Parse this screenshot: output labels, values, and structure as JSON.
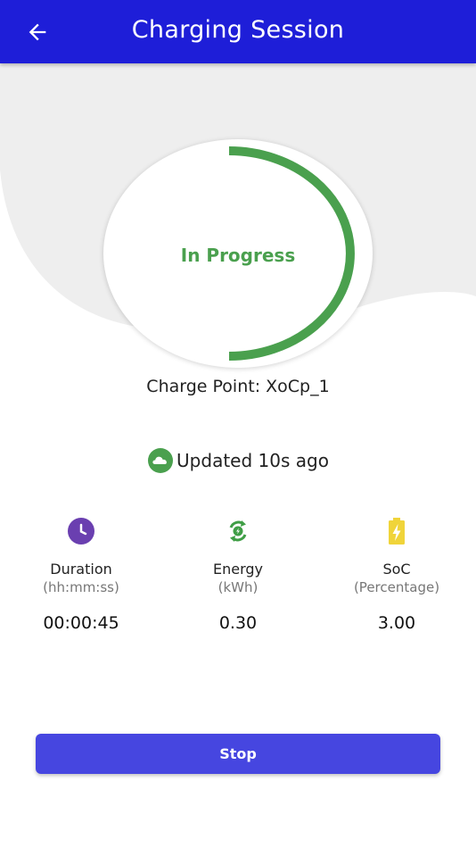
{
  "header": {
    "title": "Charging Session",
    "back_icon": "arrow-left-icon"
  },
  "status": {
    "label": "In Progress",
    "progress": 0.5,
    "color": "#4aa04e"
  },
  "charge_point": {
    "prefix": "Charge Point:",
    "id": "XoCp_1"
  },
  "updated": {
    "text": "Updated 10s ago",
    "icon": "cloud-icon"
  },
  "metrics": [
    {
      "label": "Duration",
      "unit": "(hh:mm:ss)",
      "value": "00:00:45",
      "icon": "clock-icon",
      "icon_color": "#6a3fb0"
    },
    {
      "label": "Energy",
      "unit": "(kWh)",
      "value": "0.30",
      "icon": "energy-icon",
      "icon_color": "#3f9e46"
    },
    {
      "label": "SoC",
      "unit": "(Percentage)",
      "value": "3.00",
      "icon": "battery-charging-icon",
      "icon_color": "#f0d43a"
    }
  ],
  "actions": {
    "stop_label": "Stop"
  },
  "colors": {
    "header": "#1e1ed8",
    "button": "#4646e0"
  }
}
